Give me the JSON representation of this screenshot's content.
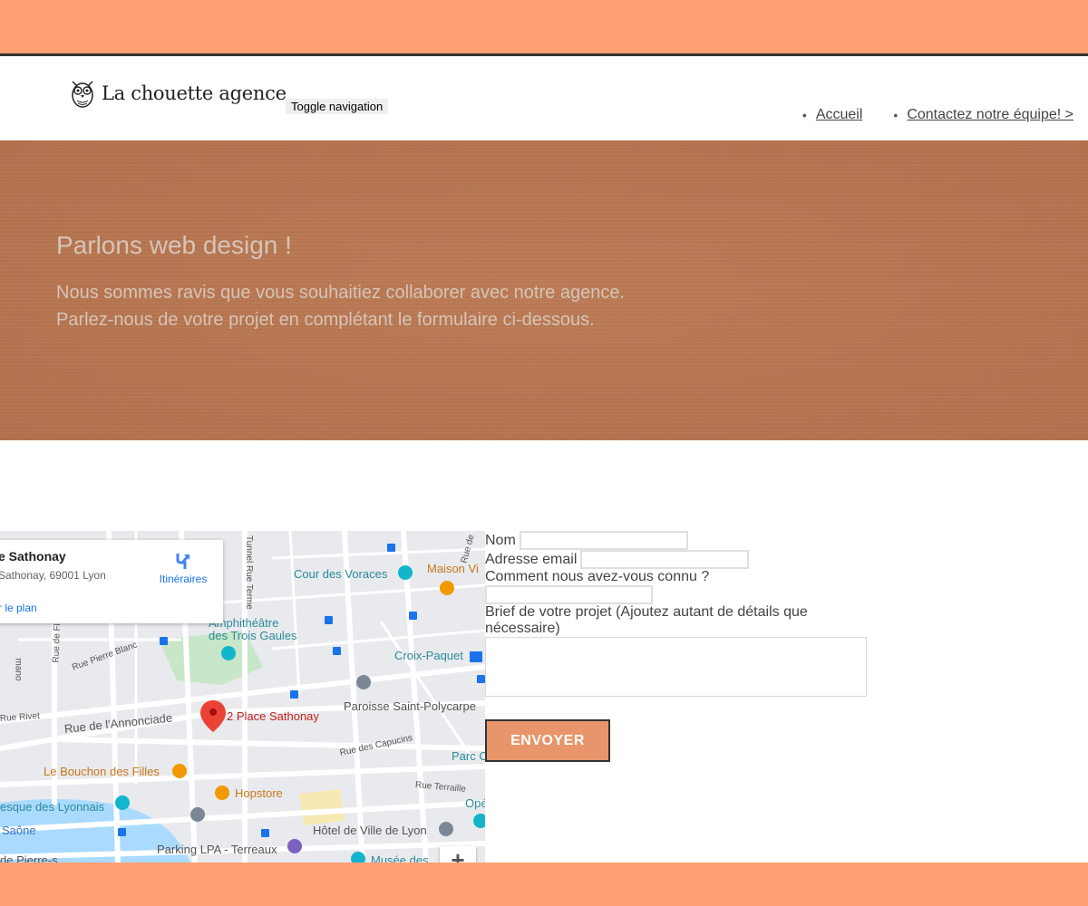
{
  "header": {
    "logo_text": "La chouette agence",
    "toggle_label": "Toggle navigation",
    "nav": [
      {
        "label": "Accueil"
      },
      {
        "label": "Contactez notre équipe! >"
      }
    ]
  },
  "hero": {
    "title": "Parlons web design !",
    "line1": "Nous sommes ravis que vous souhaitiez collaborer avec notre agence.",
    "line2": "Parlez-nous de votre projet en complétant le formulaire ci-dessous."
  },
  "map": {
    "card_title": "e Sathonay",
    "card_address": "Sathonay, 69001 Lyon",
    "card_link": "r le plan",
    "directions_label": "Itinéraires",
    "pin_label": "2 Place Sathonay",
    "labels": {
      "cour_voraces": "Cour des Voraces",
      "maison": "Maison Vi",
      "amphi1": "Amphithéâtre",
      "amphi2": "des Trois Gaules",
      "croix_paquet": "Croix-Paquet",
      "paroisse": "Paroisse Saint-Polycarpe",
      "annonciade": "Rue de l'Annonciade",
      "bouchon": "Le Bouchon des Filles",
      "hopstore": "Hopstore",
      "fresque": "esque des Lyonnais",
      "saone": "Saône",
      "hotel_ville": "Hôtel de Ville de Lyon",
      "parking": "Parking LPA - Terreaux",
      "musee": "Musée des",
      "parc": "Parc C",
      "ope": "Opé",
      "pierre": "de Pierre-s",
      "tunnel": "Tunnel Rue Terme",
      "rue_pierre_blanc": "Rue Pierre Blanc",
      "rue_rivet": "Rue Rivet",
      "rue_capucins": "Rue des Capucins",
      "rue_terraille": "Rue Terraille",
      "rue_fle": "Rue de Fles",
      "rue_de": "Rue de",
      "mano": "mano"
    },
    "zoom_in": "+"
  },
  "form": {
    "nom_label": "Nom",
    "email_label": "Adresse email",
    "source_label": "Comment nous avez-vous connu ?",
    "brief_label_1": "Brief de votre projet (Ajoutez autant de détails que",
    "brief_label_2": "nécessaire)",
    "submit_label": "ENVOYER"
  },
  "colors": {
    "band": "#ff9f72",
    "hero_bg": "#b97852",
    "button": "#e8956b"
  }
}
